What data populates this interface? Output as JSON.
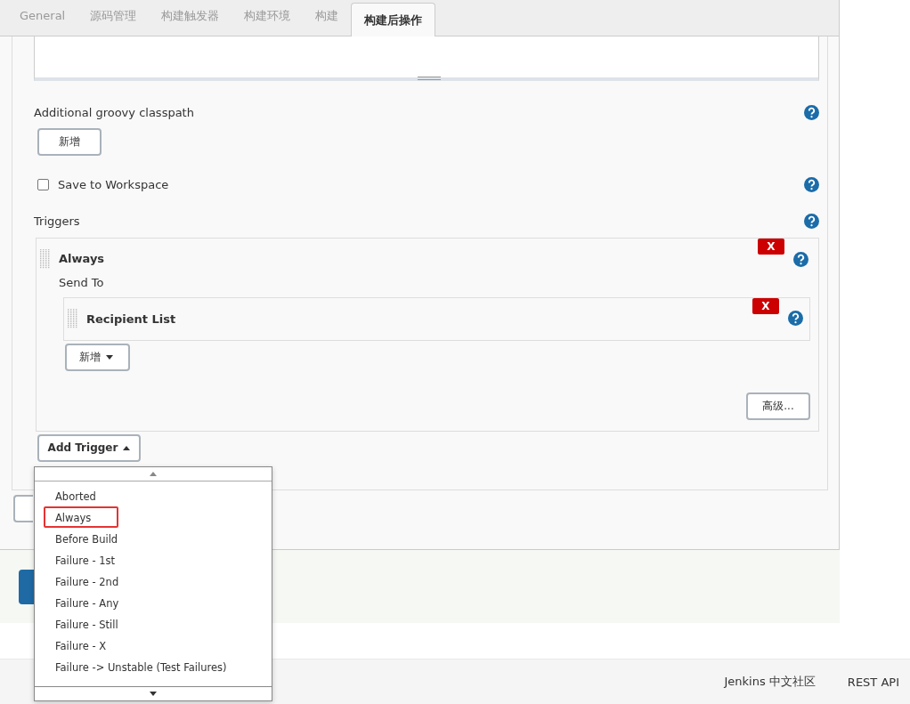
{
  "tabs": [
    {
      "label": "General",
      "selected": false
    },
    {
      "label": "源码管理",
      "selected": false
    },
    {
      "label": "构建触发器",
      "selected": false
    },
    {
      "label": "构建环境",
      "selected": false
    },
    {
      "label": "构建",
      "selected": false
    },
    {
      "label": "构建后操作",
      "selected": true
    }
  ],
  "classpath": {
    "label": "Additional groovy classpath",
    "add_button": "新增"
  },
  "save_to_workspace": {
    "label": "Save to Workspace",
    "checked": false
  },
  "triggers": {
    "label": "Triggers",
    "trigger": {
      "title": "Always",
      "delete": "X",
      "send_to": "Send To",
      "recipient": {
        "title": "Recipient List",
        "delete": "X"
      },
      "add_button": "新增",
      "advanced_button": "高级..."
    },
    "add_trigger": "Add Trigger"
  },
  "dropdown": {
    "items": [
      {
        "label": "Aborted",
        "highlighted": false
      },
      {
        "label": "Always",
        "highlighted": true
      },
      {
        "label": "Before Build",
        "highlighted": false
      },
      {
        "label": "Failure - 1st",
        "highlighted": false
      },
      {
        "label": "Failure - 2nd",
        "highlighted": false
      },
      {
        "label": "Failure - Any",
        "highlighted": false
      },
      {
        "label": "Failure - Still",
        "highlighted": false
      },
      {
        "label": "Failure - X",
        "highlighted": false
      },
      {
        "label": "Failure -> Unstable (Test Failures)",
        "highlighted": false
      }
    ]
  },
  "footer": {
    "links": [
      "Jenkins 中文社区",
      "REST API"
    ]
  }
}
